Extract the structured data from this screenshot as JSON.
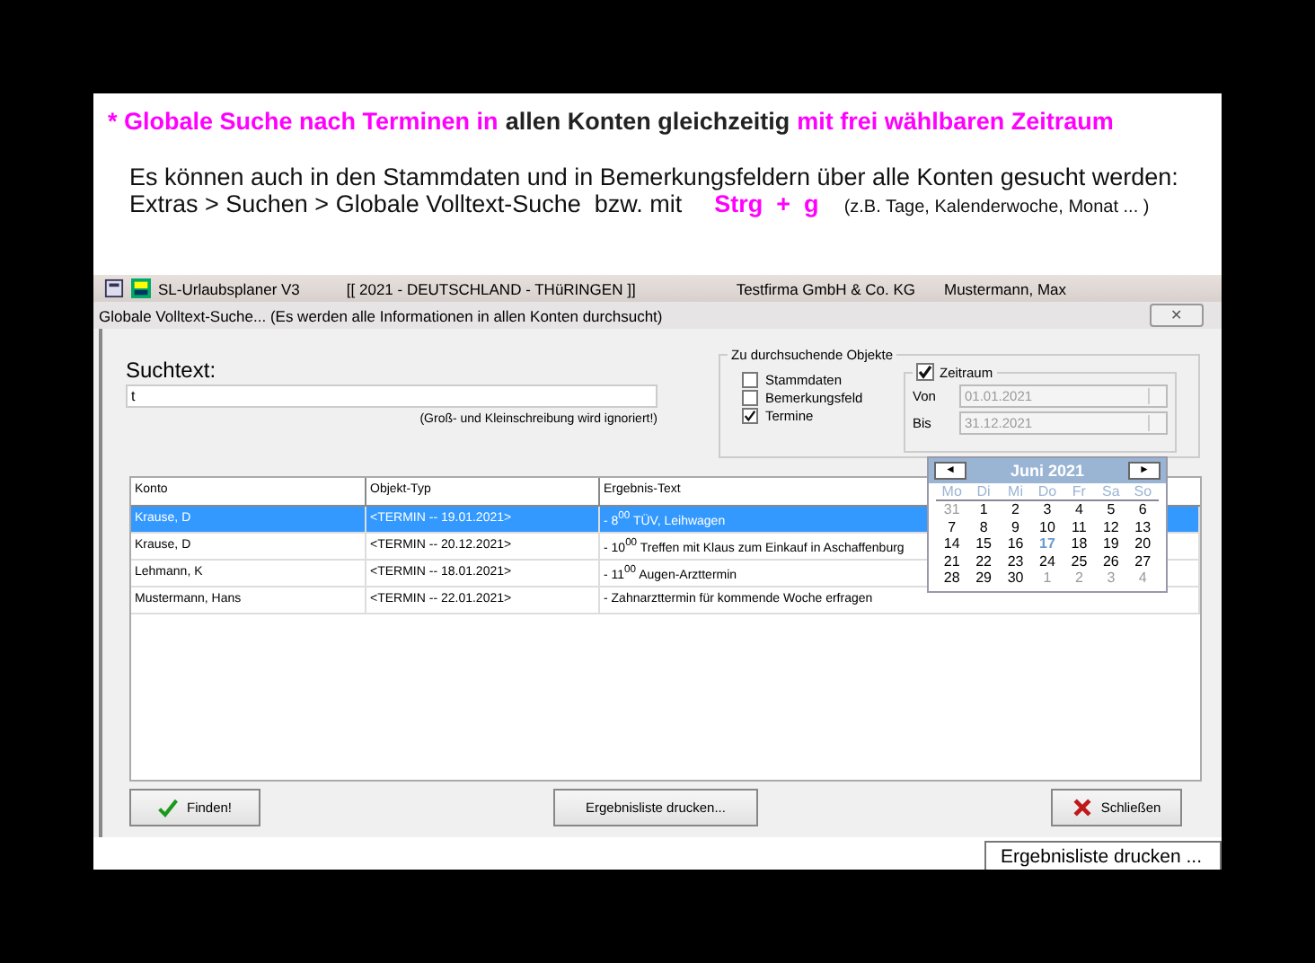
{
  "intro": {
    "heading": [
      {
        "text": "* Globale Suche nach Terminen in",
        "highlight": true
      },
      {
        "text": "allen Konten gleichzeitig",
        "highlight": false
      },
      {
        "text": "mit frei wählbaren Zeitraum",
        "highlight": true
      }
    ],
    "line_1": "Es können auch in den Stammdaten und in Bemerkungsfeldern über alle Konten gesucht werden:",
    "line_2": [
      {
        "text": "Extras > Suchen > Globale Volltext-Suche  bzw. mit",
        "kind": "plain"
      },
      {
        "text": "Strg  +  g",
        "kind": "key"
      },
      {
        "text": "(z.B. Tage, Kalenderwoche, Monat ... )",
        "kind": "note"
      }
    ]
  },
  "app_bar": {
    "title": "SL-Urlaubsplaner V3",
    "context": "[[ 2021 - DEUTSCHLAND - THüRINGEN ]]",
    "company": "Testfirma GmbH & Co. KG",
    "user": "Mustermann, Max"
  },
  "dialog": {
    "title": "Globale Volltext-Suche...  (Es werden alle Informationen in allen Konten durchsucht)",
    "close": "✕",
    "search": {
      "label": "Suchtext:",
      "value": "t",
      "hint": "(Groß- und Kleinschreibung wird ignoriert!)"
    },
    "objects": {
      "title": "Zu durchsuchende Objekte",
      "options": [
        {
          "label": "Stammdaten",
          "checked": false
        },
        {
          "label": "Bemerkungsfeld",
          "checked": false
        },
        {
          "label": "Termine",
          "checked": true
        }
      ],
      "period": {
        "label": "Zeitraum",
        "checked": true,
        "from_label": "Von",
        "from": "01.01.2021",
        "to_label": "Bis",
        "to": "31.12.2021"
      }
    },
    "calendar": {
      "month": "Juni 2021",
      "prev": "◄",
      "next": "►",
      "weekdays": [
        "Mo",
        "Di",
        "Mi",
        "Do",
        "Fr",
        "Sa",
        "So"
      ],
      "days": [
        {
          "label": "31",
          "muted": true,
          "today": false
        },
        {
          "label": "1",
          "muted": false,
          "today": false
        },
        {
          "label": "2",
          "muted": false,
          "today": false
        },
        {
          "label": "3",
          "muted": false,
          "today": false
        },
        {
          "label": "4",
          "muted": false,
          "today": false
        },
        {
          "label": "5",
          "muted": false,
          "today": false
        },
        {
          "label": "6",
          "muted": false,
          "today": false
        },
        {
          "label": "7",
          "muted": false,
          "today": false
        },
        {
          "label": "8",
          "muted": false,
          "today": false
        },
        {
          "label": "9",
          "muted": false,
          "today": false
        },
        {
          "label": "10",
          "muted": false,
          "today": false
        },
        {
          "label": "11",
          "muted": false,
          "today": false
        },
        {
          "label": "12",
          "muted": false,
          "today": false
        },
        {
          "label": "13",
          "muted": false,
          "today": false
        },
        {
          "label": "14",
          "muted": false,
          "today": false
        },
        {
          "label": "15",
          "muted": false,
          "today": false
        },
        {
          "label": "16",
          "muted": false,
          "today": false
        },
        {
          "label": "17",
          "muted": false,
          "today": true
        },
        {
          "label": "18",
          "muted": false,
          "today": false
        },
        {
          "label": "19",
          "muted": false,
          "today": false
        },
        {
          "label": "20",
          "muted": false,
          "today": false
        },
        {
          "label": "21",
          "muted": false,
          "today": false
        },
        {
          "label": "22",
          "muted": false,
          "today": false
        },
        {
          "label": "23",
          "muted": false,
          "today": false
        },
        {
          "label": "24",
          "muted": false,
          "today": false
        },
        {
          "label": "25",
          "muted": false,
          "today": false
        },
        {
          "label": "26",
          "muted": false,
          "today": false
        },
        {
          "label": "27",
          "muted": false,
          "today": false
        },
        {
          "label": "28",
          "muted": false,
          "today": false
        },
        {
          "label": "29",
          "muted": false,
          "today": false
        },
        {
          "label": "30",
          "muted": false,
          "today": false
        },
        {
          "label": "1",
          "muted": true,
          "today": false
        },
        {
          "label": "2",
          "muted": true,
          "today": false
        },
        {
          "label": "3",
          "muted": true,
          "today": false
        },
        {
          "label": "4",
          "muted": true,
          "today": false
        }
      ]
    },
    "table": {
      "columns": [
        "Konto",
        "Objekt-Typ",
        "Ergebnis-Text"
      ],
      "rows": [
        {
          "cells": [
            "Krause, D",
            "<TERMIN -- 19.01.2021>",
            "- 8$^{00}$ TÜV, Leihwagen"
          ],
          "selected": true
        },
        {
          "cells": [
            "Krause, D",
            "<TERMIN -- 20.12.2021>",
            "- 10$^{00}$ Treffen mit Klaus zum Einkauf in Aschaffenburg"
          ],
          "selected": false
        },
        {
          "cells": [
            "Lehmann, K",
            "<TERMIN -- 18.01.2021>",
            "- 11$^{00}$ Augen-Arzttermin"
          ],
          "selected": false
        },
        {
          "cells": [
            "Mustermann, Hans",
            "<TERMIN -- 22.01.2021>",
            "- Zahnarzttermin für kommende Woche erfragen"
          ],
          "selected": false
        }
      ]
    },
    "buttons": {
      "find": "Finden!",
      "print": "Ergebnisliste drucken...",
      "close": "Schließen"
    }
  },
  "tooltip": "Ergebnisliste drucken ..."
}
